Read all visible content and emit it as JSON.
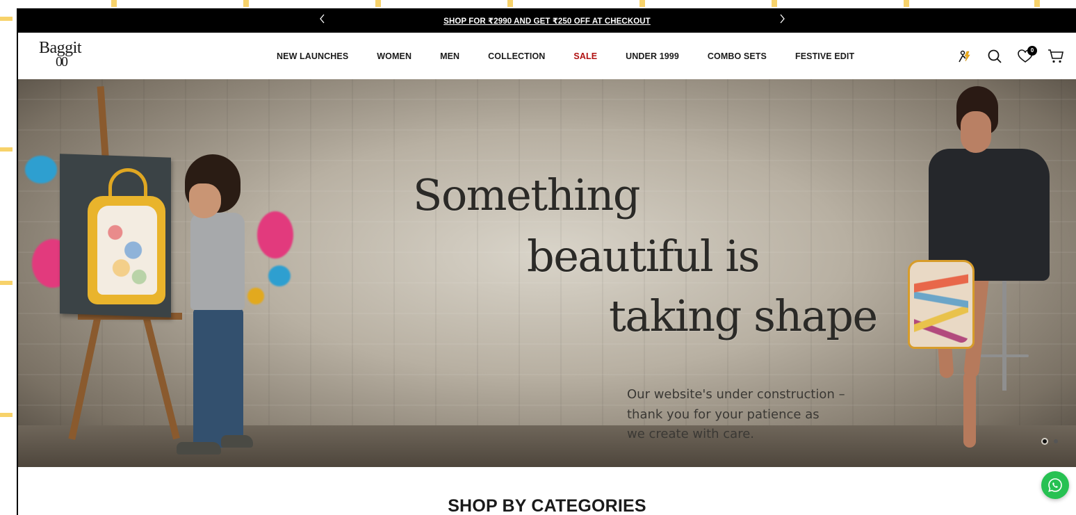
{
  "announcement": {
    "text": "SHOP FOR ₹2990 AND GET ₹250 OFF AT CHECKOUT",
    "prev_icon": "chevron-left-icon",
    "next_icon": "chevron-right-icon"
  },
  "header": {
    "logo_top": "Baggit",
    "logo_bottom": "00",
    "nav": [
      {
        "label": "NEW LAUNCHES"
      },
      {
        "label": "WOMEN"
      },
      {
        "label": "MEN"
      },
      {
        "label": "COLLECTION"
      },
      {
        "label": "SALE",
        "color": "#b01010"
      },
      {
        "label": "UNDER 1999"
      },
      {
        "label": "COMBO SETS"
      },
      {
        "label": "FESTIVE EDIT"
      }
    ],
    "icons": [
      "flash-sale-icon",
      "search-icon",
      "wishlist-heart-icon",
      "cart-icon"
    ],
    "wishlist_count": "0"
  },
  "hero": {
    "headline": [
      "Something",
      "beautiful is",
      "taking shape"
    ],
    "subtext": [
      "Our website's under construction –",
      "thank you for your patience as",
      "we create with care."
    ],
    "slides_total": 2,
    "active_slide": 1
  },
  "sections": {
    "categories_title": "SHOP BY CATEGORIES"
  },
  "colors": {
    "announcement_bg": "#000000",
    "sale": "#b01010",
    "whatsapp": "#27c152"
  }
}
